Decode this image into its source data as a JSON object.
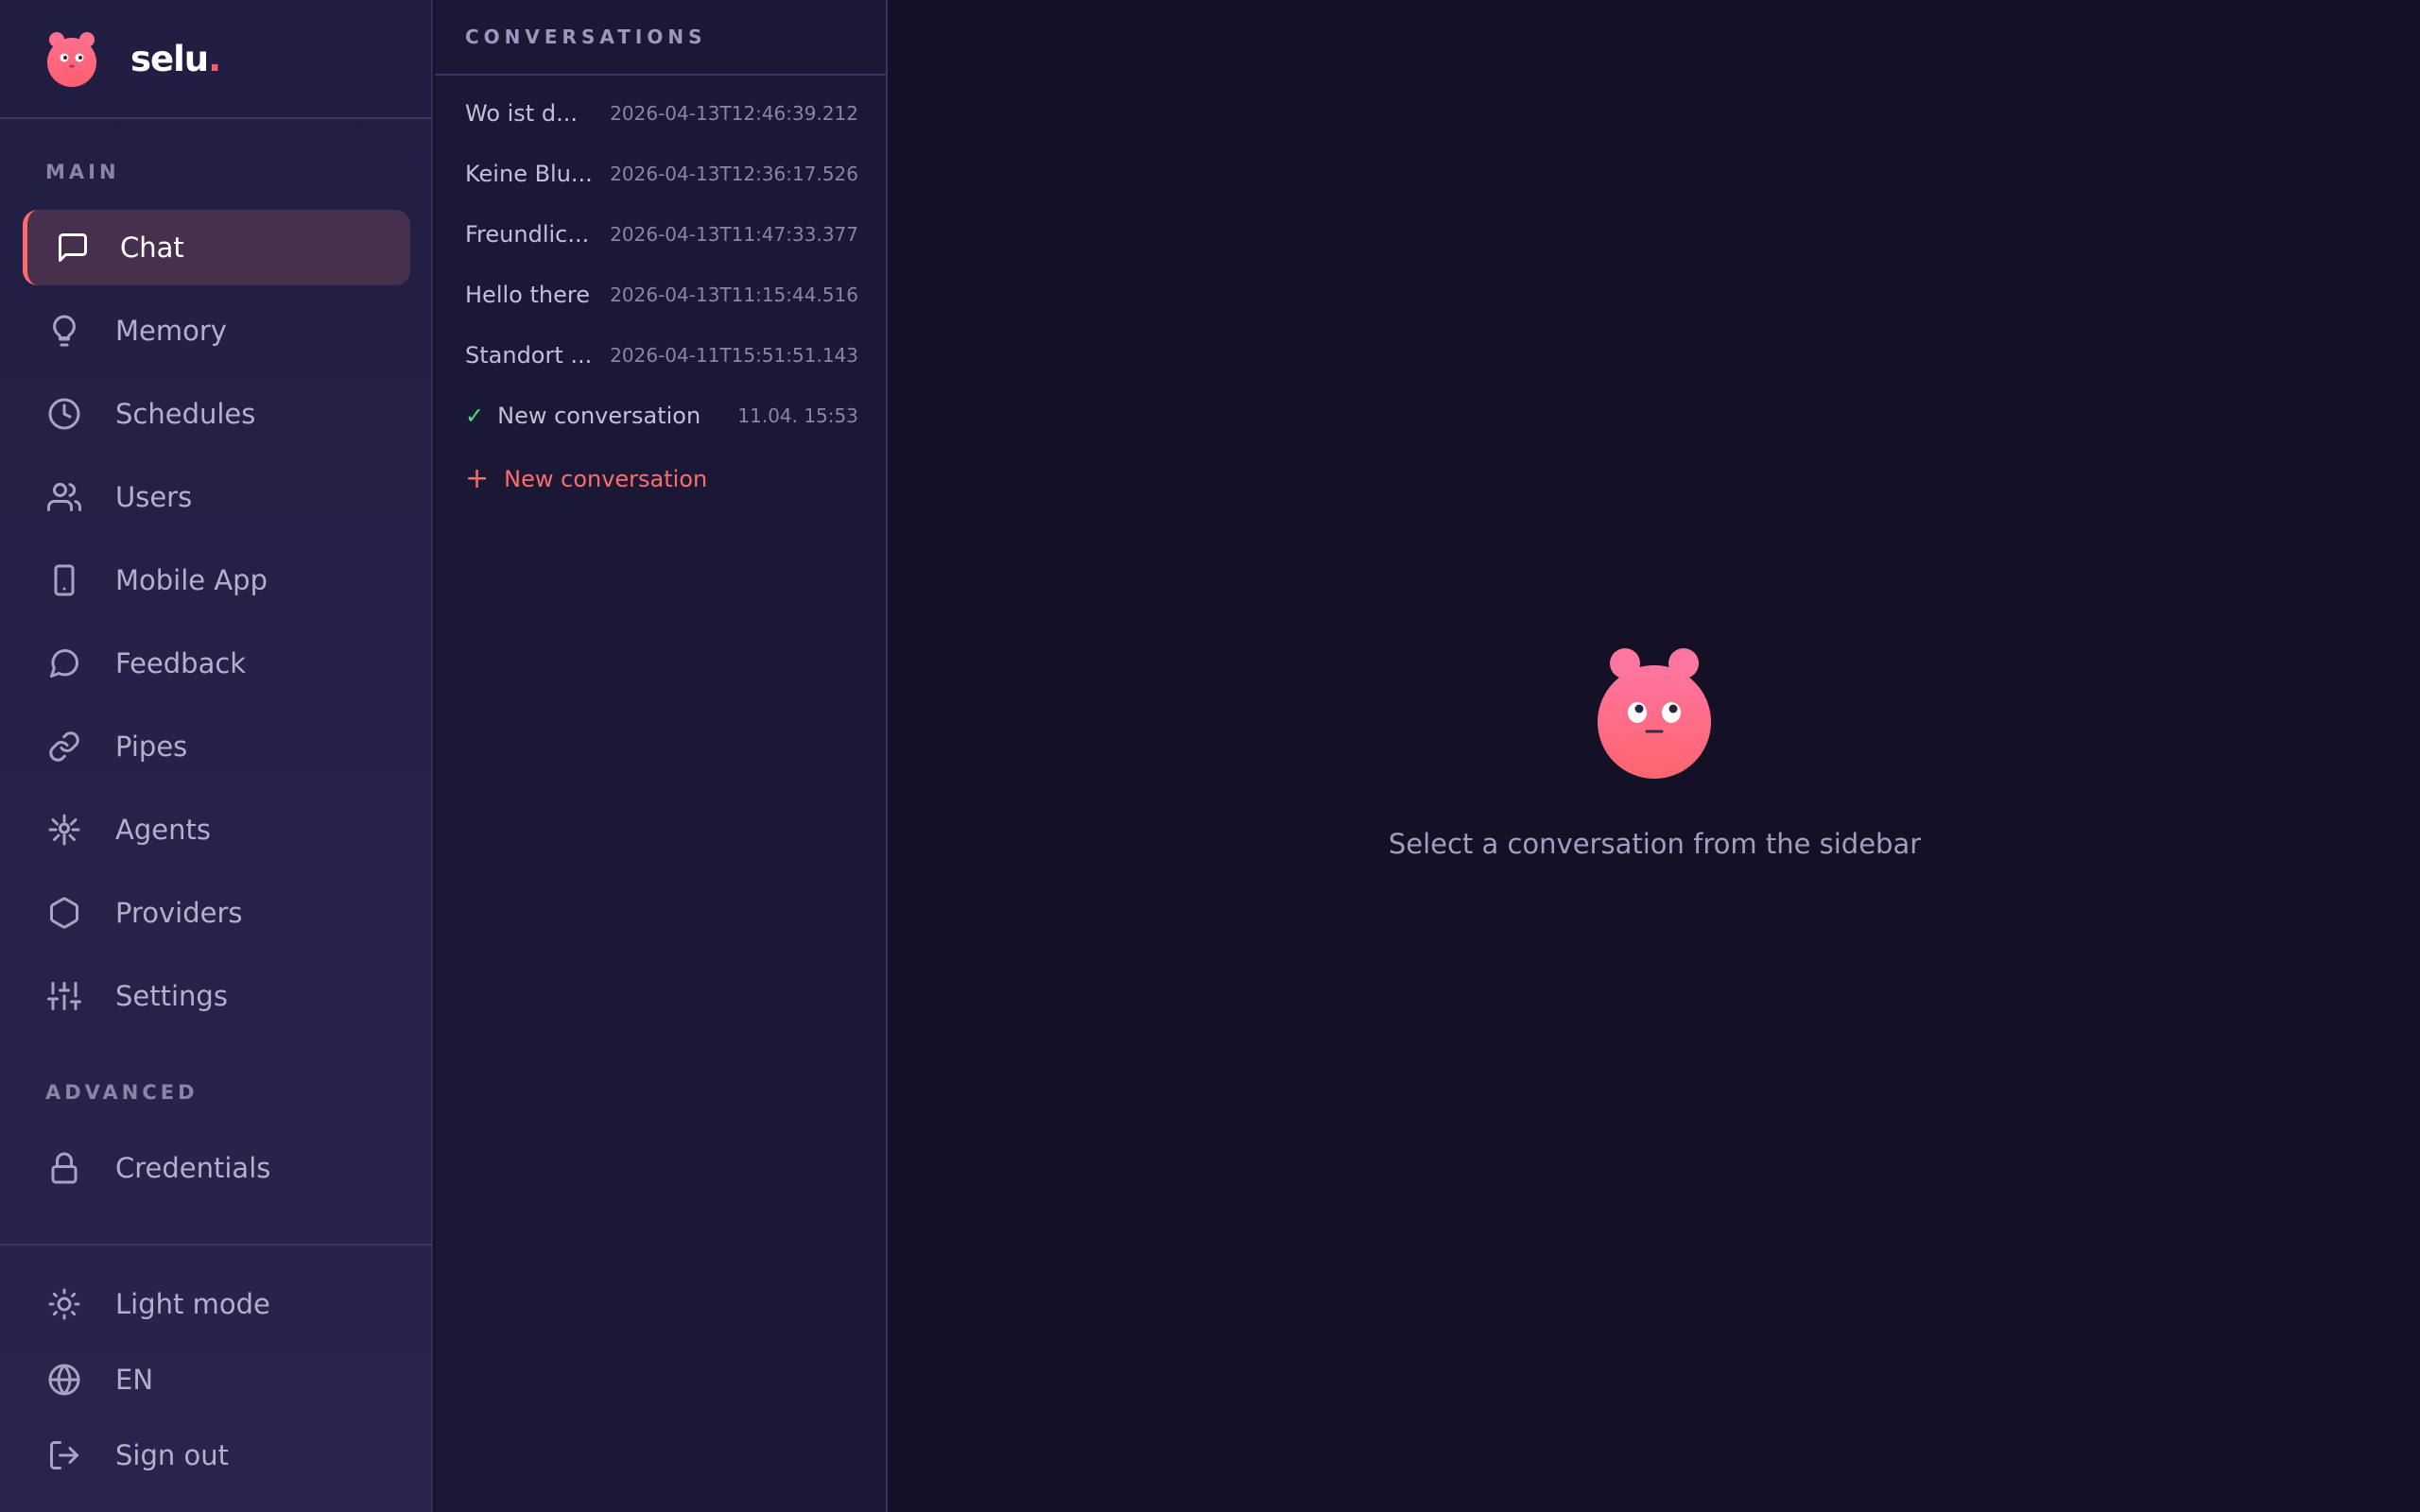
{
  "brand": {
    "name": "selu",
    "dot": "."
  },
  "nav": {
    "main_label": "MAIN",
    "advanced_label": "ADVANCED",
    "items": [
      {
        "label": "Chat",
        "icon": "message-square-icon",
        "active": true
      },
      {
        "label": "Memory",
        "icon": "lightbulb-icon"
      },
      {
        "label": "Schedules",
        "icon": "clock-icon"
      },
      {
        "label": "Users",
        "icon": "users-icon"
      },
      {
        "label": "Mobile App",
        "icon": "smartphone-icon"
      },
      {
        "label": "Feedback",
        "icon": "message-circle-icon"
      },
      {
        "label": "Pipes",
        "icon": "link-icon"
      },
      {
        "label": "Agents",
        "icon": "agent-icon"
      },
      {
        "label": "Providers",
        "icon": "hexagon-icon"
      },
      {
        "label": "Settings",
        "icon": "sliders-icon"
      }
    ],
    "advanced_items": [
      {
        "label": "Credentials",
        "icon": "lock-icon"
      }
    ],
    "footer": [
      {
        "label": "Light mode",
        "icon": "sun-icon"
      },
      {
        "label": "EN",
        "icon": "globe-icon"
      },
      {
        "label": "Sign out",
        "icon": "log-out-icon"
      }
    ]
  },
  "conversations": {
    "header": "CONVERSATIONS",
    "items": [
      {
        "title": "Wo ist d...",
        "time": "2026-04-13T12:46:39.212"
      },
      {
        "title": "Keine Blu...",
        "time": "2026-04-13T12:36:17.526"
      },
      {
        "title": "Freundlic...",
        "time": "2026-04-13T11:47:33.377"
      },
      {
        "title": "Hello there",
        "time": "2026-04-13T11:15:44.516"
      },
      {
        "title": "Standort ...",
        "time": "2026-04-11T15:51:51.143"
      },
      {
        "title": "New conversation",
        "time": "11.04. 15:53",
        "checked": true,
        "check": "✓"
      }
    ],
    "new_label": "New conversation",
    "new_icon": "+"
  },
  "main": {
    "empty_message": "Select a conversation from the sidebar"
  },
  "colors": {
    "accent": "#ff6b6b",
    "bg": "#141126",
    "sidebar": "#221e42",
    "panel": "#1b1836",
    "check": "#4ade80"
  }
}
